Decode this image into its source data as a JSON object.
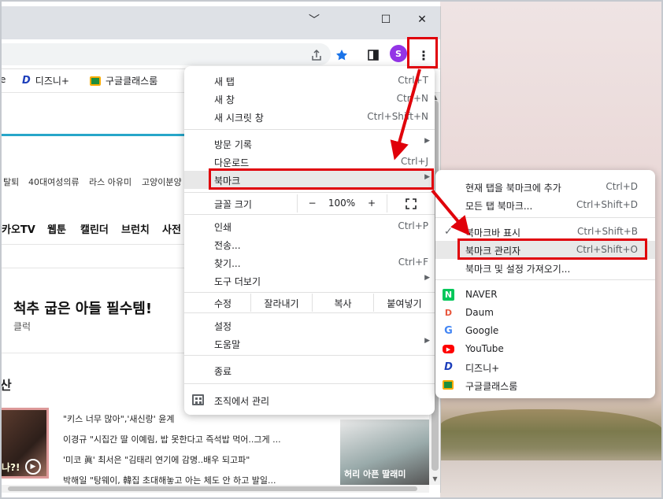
{
  "window_controls": {
    "minimize": "﹀",
    "maximize": "☐",
    "close": "✕"
  },
  "toolbar": {
    "avatar_letter": "S",
    "menu_icon": "⋮"
  },
  "bookmarks_bar": {
    "items": [
      {
        "label": "e"
      },
      {
        "label": "디즈니+"
      },
      {
        "label": "구글클래스룸"
      }
    ]
  },
  "page": {
    "trending": [
      "탈퇴",
      "40대여성의류",
      "라스 아유미",
      "고양이분양"
    ],
    "nav": [
      "카오TV",
      "웹툰",
      "캘린더",
      "브런치",
      "사전"
    ],
    "ad_title": "척추 굽은 아들 필수템!",
    "ad_sub": "클럭",
    "section_title": "산",
    "thumb_text": "나?!",
    "news": [
      "\"키스 너무 많아\",'새신랑' 윤계",
      "이경규 \"시집간 딸 이예림, 밥 못한다고 즉석밥 먹어..그게 ...",
      "'미코 眞' 최서은 \"김태리 연기에 감명..배우 되고파\"",
      "박해일 \"탕웨이, 韓집 초대해놓고 아는 체도 안 하고 발일..."
    ],
    "right_caption": "허리 아픈 딸래미"
  },
  "menu": {
    "new_tab": {
      "label": "새 탭",
      "shortcut": "Ctrl+T"
    },
    "new_window": {
      "label": "새 창",
      "shortcut": "Ctrl+N"
    },
    "incognito": {
      "label": "새 시크릿 창",
      "shortcut": "Ctrl+Shift+N"
    },
    "history": {
      "label": "방문 기록"
    },
    "downloads": {
      "label": "다운로드",
      "shortcut": "Ctrl+J"
    },
    "bookmarks": {
      "label": "북마크"
    },
    "zoom": {
      "label": "글꼴 크기",
      "minus": "−",
      "value": "100%",
      "plus": "+"
    },
    "print": {
      "label": "인쇄",
      "shortcut": "Ctrl+P"
    },
    "cast": {
      "label": "전송..."
    },
    "find": {
      "label": "찾기...",
      "shortcut": "Ctrl+F"
    },
    "more_tools": {
      "label": "도구 더보기"
    },
    "edit": {
      "label": "수정",
      "cut": "잘라내기",
      "copy": "복사",
      "paste": "붙여넣기"
    },
    "settings": {
      "label": "설정"
    },
    "help": {
      "label": "도움말"
    },
    "exit": {
      "label": "종료"
    },
    "managed": {
      "label": "조직에서 관리"
    }
  },
  "submenu": {
    "add_bookmark": {
      "label": "현재 탭을 북마크에 추가",
      "shortcut": "Ctrl+D"
    },
    "bookmark_all": {
      "label": "모든 탭 북마크...",
      "shortcut": "Ctrl+Shift+D"
    },
    "show_bar": {
      "label": "북마크바 표시",
      "shortcut": "Ctrl+Shift+B"
    },
    "manager": {
      "label": "북마크 관리자",
      "shortcut": "Ctrl+Shift+O"
    },
    "import": {
      "label": "북마크 및 설정 가져오기..."
    },
    "sites": [
      {
        "label": "NAVER",
        "icon": "naver-icon"
      },
      {
        "label": "Daum",
        "icon": "daum-icon"
      },
      {
        "label": "Google",
        "icon": "google-icon"
      },
      {
        "label": "YouTube",
        "icon": "youtube-icon"
      },
      {
        "label": "디즈니+",
        "icon": "disney-icon"
      },
      {
        "label": "구글클래스룸",
        "icon": "classroom-icon"
      }
    ]
  },
  "colors": {
    "annotation_red": "#e0000a",
    "highlight": "#e8e8e8",
    "accent_blue": "#1a73e8"
  }
}
